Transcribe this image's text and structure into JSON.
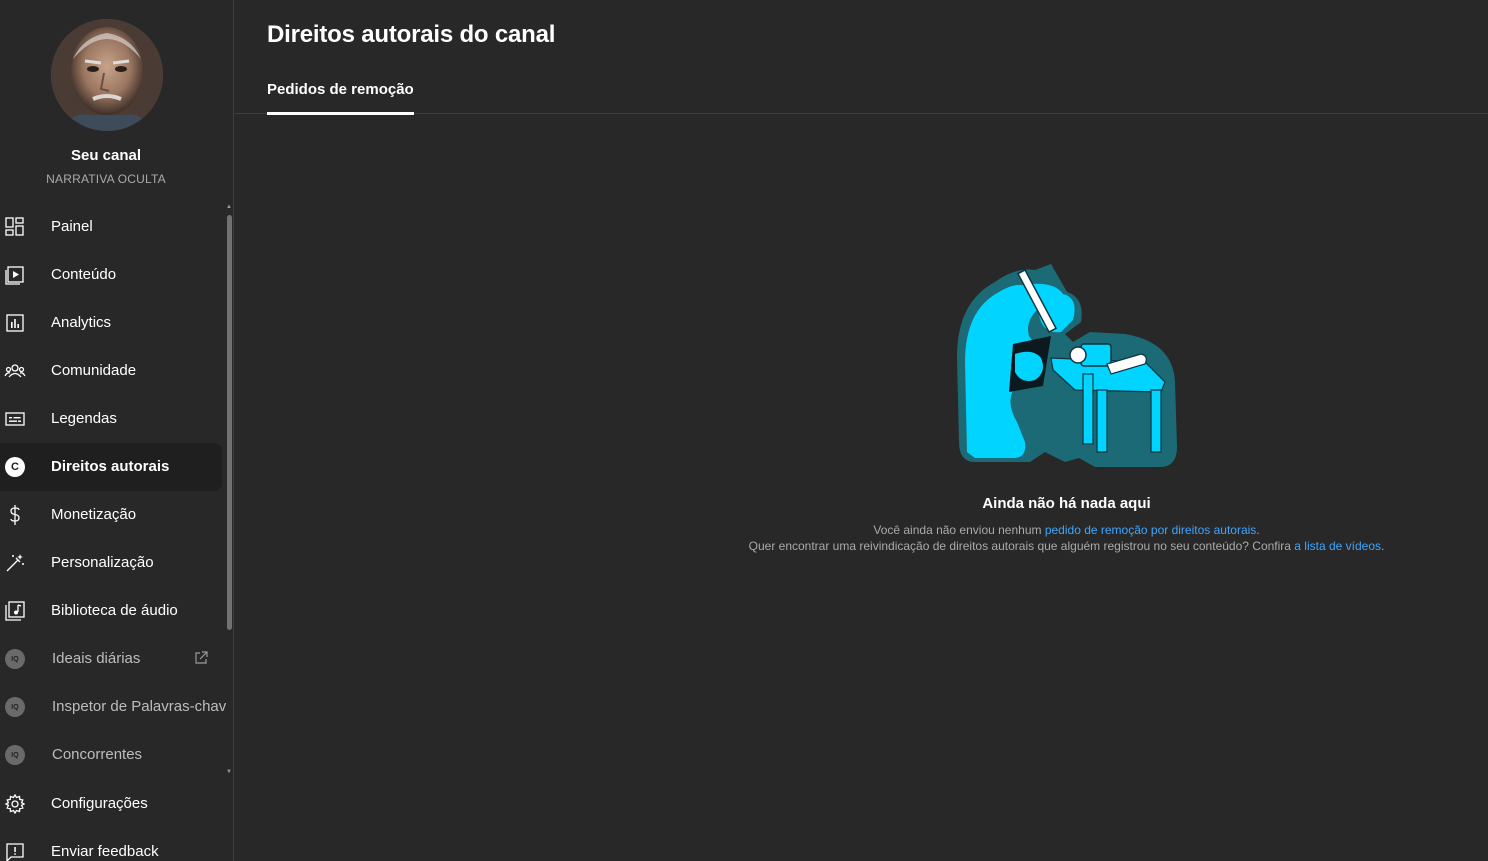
{
  "sidebar": {
    "channel_title": "Seu canal",
    "channel_name": "NARRATIVA OCULTA",
    "items": [
      {
        "label": "Painel",
        "icon": "dashboard-icon"
      },
      {
        "label": "Conteúdo",
        "icon": "content-icon"
      },
      {
        "label": "Analytics",
        "icon": "analytics-icon"
      },
      {
        "label": "Comunidade",
        "icon": "community-icon"
      },
      {
        "label": "Legendas",
        "icon": "subtitles-icon"
      },
      {
        "label": "Direitos autorais",
        "icon": "copyright-icon",
        "active": true
      },
      {
        "label": "Monetização",
        "icon": "dollar-icon"
      },
      {
        "label": "Personalização",
        "icon": "magic-wand-icon"
      },
      {
        "label": "Biblioteca de áudio",
        "icon": "audio-library-icon"
      },
      {
        "label": "Ideais diárias",
        "icon": "vidiq-icon",
        "badge": "IQ"
      },
      {
        "label": "Inspetor de Palavras-chav",
        "icon": "vidiq-icon",
        "badge": "IQ"
      },
      {
        "label": "Concorrentes",
        "icon": "vidiq-icon",
        "badge": "IQ"
      }
    ],
    "copyright_badge": "C",
    "bottom_items": [
      {
        "label": "Configurações",
        "icon": "gear-icon"
      },
      {
        "label": "Enviar feedback",
        "icon": "feedback-icon"
      }
    ]
  },
  "main": {
    "title": "Direitos autorais do canal",
    "tabs": [
      {
        "label": "Pedidos de remoção",
        "active": true
      }
    ],
    "empty_state": {
      "title": "Ainda não há nada aqui",
      "line1_prefix": "Você ainda não enviou nenhum ",
      "line1_link": "pedido de remoção por direitos autorais",
      "line1_suffix": ".",
      "line2_prefix": "Quer encontrar uma reivindicação de direitos autorais que alguém registrou no seu conteúdo? Confira ",
      "line2_link": "a lista de vídeos",
      "line2_suffix": "."
    }
  },
  "colors": {
    "background": "#282828",
    "link": "#3ea6ff",
    "illustration_primary": "#00d4ff",
    "illustration_outline": "#1c6a76"
  }
}
